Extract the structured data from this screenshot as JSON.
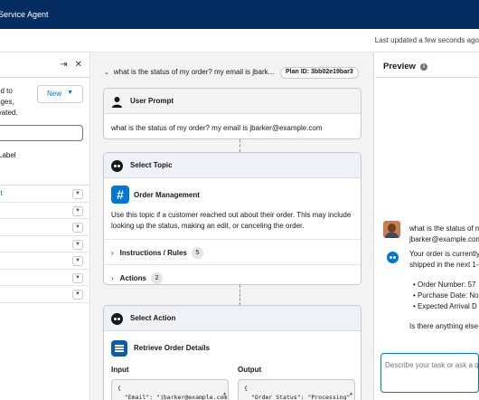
{
  "app": {
    "title": "Service Agent"
  },
  "subheader": {
    "last_updated": "Last updated a few seconds ago"
  },
  "left_panel": {
    "description_lines": [
      "ed to",
      "ages,",
      "ivated."
    ],
    "new_button": "New",
    "label_text": "Label",
    "rows": [
      "nt",
      "",
      "",
      "",
      "",
      "",
      ""
    ]
  },
  "plan": {
    "utterance": "what is the status of my order? my email is jbark...",
    "plan_id": "Plan ID: 3bb02e19bar3",
    "user_prompt": {
      "title": "User Prompt",
      "text": "what is the status of my order? my email is jbarker@example.com"
    },
    "select_topic": {
      "title": "Select Topic",
      "topic_icon": "#",
      "topic_name": "Order Management",
      "topic_description": "Use this topic if a customer reached out about their order. This may include looking up the status, making an edit, or canceling the order.",
      "instructions_label": "Instructions / Rules",
      "instructions_count": "5",
      "actions_label": "Actions",
      "actions_count": "2"
    },
    "select_action": {
      "title": "Select Action",
      "action_name": "Retrieve Order Details",
      "input_label": "Input",
      "output_label": "Output",
      "input_code": "{\n  \"Email\": \"jbarker@example.com\"",
      "output_code": "{\n  \"Order_Status\": \"Processing\""
    }
  },
  "preview": {
    "title": "Preview",
    "user_message_lines": [
      "what is the status of m",
      "jbarker@example.com"
    ],
    "agent_message_lines": [
      "Your order is currently",
      "shipped in the next 1-"
    ],
    "agent_bullets": [
      "Order Number: 57",
      "Purchase Date: No",
      "Expected Arrival D"
    ],
    "agent_closing": "Is there anything else",
    "composer_placeholder": "Describe your task or ask a qu"
  }
}
